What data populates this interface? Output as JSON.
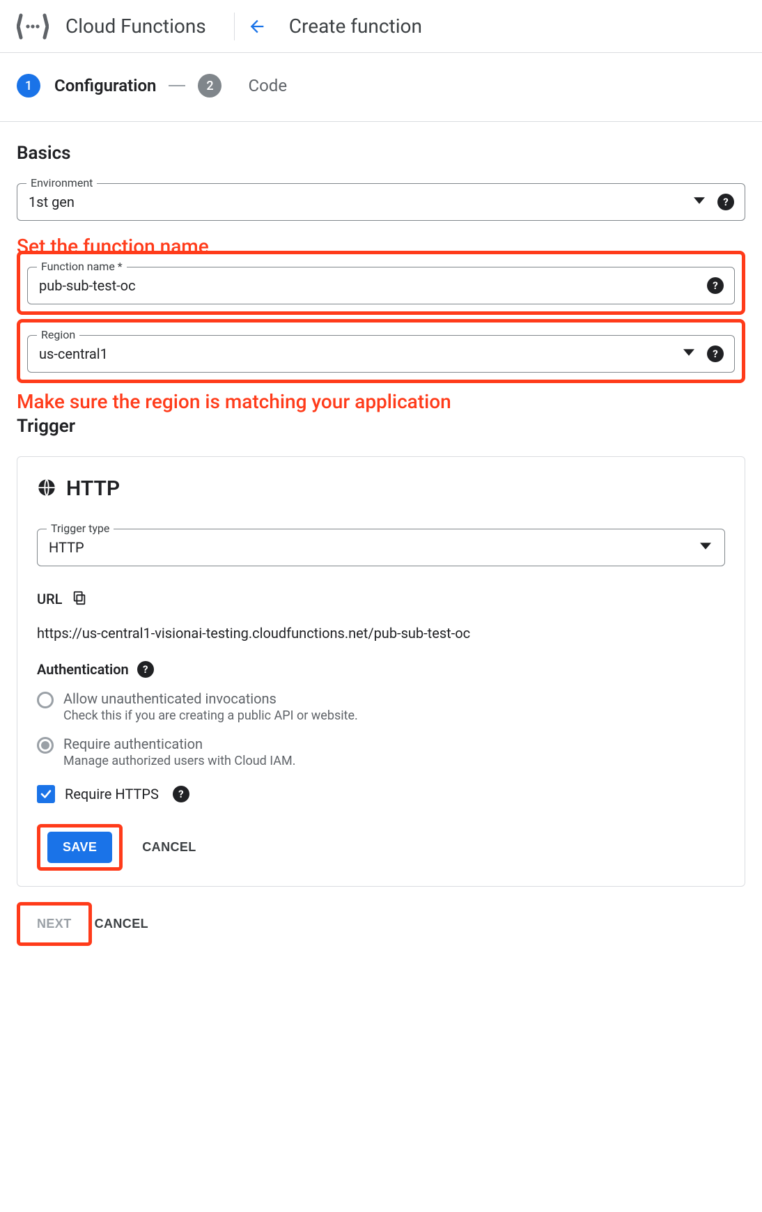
{
  "header": {
    "product": "Cloud Functions",
    "page": "Create function"
  },
  "stepper": {
    "step1": {
      "num": "1",
      "label": "Configuration"
    },
    "step2": {
      "num": "2",
      "label": "Code"
    }
  },
  "annotations": {
    "name": "Set the function name",
    "region": "Make sure the region is matching your application"
  },
  "basics": {
    "title": "Basics",
    "env_label": "Environment",
    "env_value": "1st gen",
    "name_label": "Function name *",
    "name_value": "pub-sub-test-oc",
    "region_label": "Region",
    "region_value": "us-central1"
  },
  "trigger": {
    "section": "Trigger",
    "type_title": "HTTP",
    "type_label": "Trigger type",
    "type_value": "HTTP",
    "url_label": "URL",
    "url_value": "https://us-central1-visionai-testing.cloudfunctions.net/pub-sub-test-oc",
    "auth_title": "Authentication",
    "opt1_title": "Allow unauthenticated invocations",
    "opt1_sub": "Check this if you are creating a public API or website.",
    "opt2_title": "Require authentication",
    "opt2_sub": "Manage authorized users with Cloud IAM.",
    "https_label": "Require HTTPS",
    "save": "SAVE",
    "cancel": "CANCEL"
  },
  "footer": {
    "next": "NEXT",
    "cancel": "CANCEL"
  }
}
